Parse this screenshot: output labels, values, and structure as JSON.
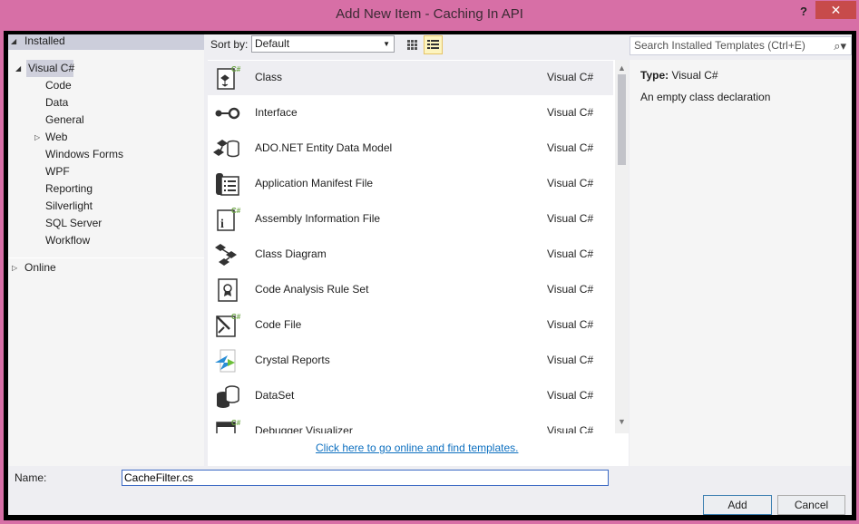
{
  "window": {
    "title": "Add New Item - Caching In API",
    "help_label": "?",
    "close_label": "✕"
  },
  "tree": {
    "installed": "Installed",
    "visual_csharp": "Visual C#",
    "children": [
      "Code",
      "Data",
      "General",
      "Web",
      "Windows Forms",
      "WPF",
      "Reporting",
      "Silverlight",
      "SQL Server",
      "Workflow"
    ],
    "online": "Online"
  },
  "toolbar": {
    "sort_label": "Sort by:",
    "sort_value": "Default"
  },
  "search": {
    "placeholder": "Search Installed Templates (Ctrl+E)"
  },
  "templates": [
    {
      "name": "Class",
      "lang": "Visual C#",
      "icon": "class-icon"
    },
    {
      "name": "Interface",
      "lang": "Visual C#",
      "icon": "interface-icon"
    },
    {
      "name": "ADO.NET Entity Data Model",
      "lang": "Visual C#",
      "icon": "entity-model-icon"
    },
    {
      "name": "Application Manifest File",
      "lang": "Visual C#",
      "icon": "manifest-icon"
    },
    {
      "name": "Assembly Information File",
      "lang": "Visual C#",
      "icon": "assembly-info-icon"
    },
    {
      "name": "Class Diagram",
      "lang": "Visual C#",
      "icon": "class-diagram-icon"
    },
    {
      "name": "Code Analysis Rule Set",
      "lang": "Visual C#",
      "icon": "rule-set-icon"
    },
    {
      "name": "Code File",
      "lang": "Visual C#",
      "icon": "code-file-icon"
    },
    {
      "name": "Crystal Reports",
      "lang": "Visual C#",
      "icon": "crystal-reports-icon"
    },
    {
      "name": "DataSet",
      "lang": "Visual C#",
      "icon": "dataset-icon"
    },
    {
      "name": "Debugger Visualizer",
      "lang": "Visual C#",
      "icon": "debugger-visualizer-icon"
    }
  ],
  "online_link": "Click here to go online and find templates.",
  "details": {
    "type_label": "Type:",
    "type_value": "Visual C#",
    "description": "An empty class declaration"
  },
  "name_field": {
    "label": "Name:",
    "value": "CacheFilter.cs"
  },
  "buttons": {
    "add": "Add",
    "cancel": "Cancel"
  },
  "colors": {
    "titlebar": "#d76fa6",
    "close": "#c74b4b",
    "link": "#0e70c0",
    "csharp_badge": "#68a33f"
  }
}
